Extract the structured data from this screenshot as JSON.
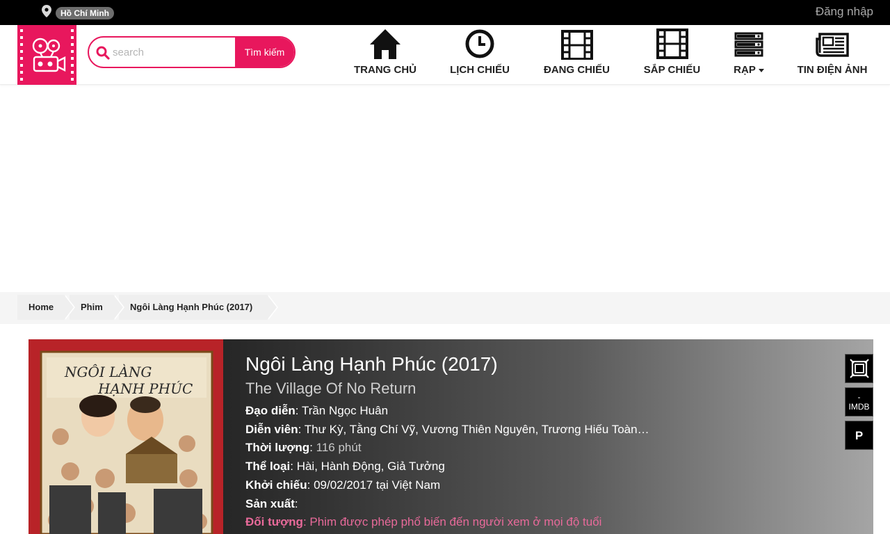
{
  "topbar": {
    "city": "Hồ Chí Minh",
    "login": "Đăng nhập"
  },
  "search": {
    "placeholder": "search",
    "button": "Tìm kiếm"
  },
  "nav": {
    "home": "TRANG CHỦ",
    "schedule": "LỊCH CHIẾU",
    "now_showing": "ĐANG CHIẾU",
    "coming_soon": "SẮP CHIẾU",
    "cinemas": "RẠP",
    "news": "TIN ĐIỆN ẢNH"
  },
  "breadcrumb": {
    "home": "Home",
    "movies": "Phim",
    "current": "Ngôi Làng Hạnh Phúc (2017)"
  },
  "movie": {
    "title": "Ngôi Làng Hạnh Phúc (2017)",
    "subtitle": "The Village Of No Return",
    "director_label": "Đạo diễn",
    "director": "Trần Ngọc Huân",
    "cast_label": "Diễn viên",
    "cast": "Thư Kỳ, Tằng Chí Vỹ, Vương Thiên Nguyên, Trương Hiếu Toàn…",
    "duration_label": "Thời lượng",
    "duration": "116 phút",
    "genre_label": "Thể loại",
    "genre": "Hài, Hành Động, Giả Tưởng",
    "release_label": "Khởi chiếu",
    "release": "09/02/2017 tại Việt Nam",
    "producer_label": "Sản xuất",
    "producer": "",
    "audience_label": "Đối tượng",
    "audience": "Phim được phép phổ biến đến người xem ở mọi độ tuổi",
    "imdb_score": "-",
    "imdb_label": "IMDB",
    "rating": "P",
    "poster_title_line1": "NGÔI LÀNG",
    "poster_title_line2": "HẠNH PHÚC"
  },
  "colors": {
    "brand": "#e8175d",
    "topbar": "#000000",
    "audience_text": "#e86a9a"
  },
  "icons": {
    "location": "map-pin-icon",
    "search": "magnifier-icon",
    "home": "house-icon",
    "schedule": "clock-icon",
    "now_showing": "film-strip-icon",
    "coming_soon": "film-strip-icon",
    "cinemas": "server-rack-icon",
    "news": "newspaper-icon",
    "fullscreen": "frame-icon"
  }
}
